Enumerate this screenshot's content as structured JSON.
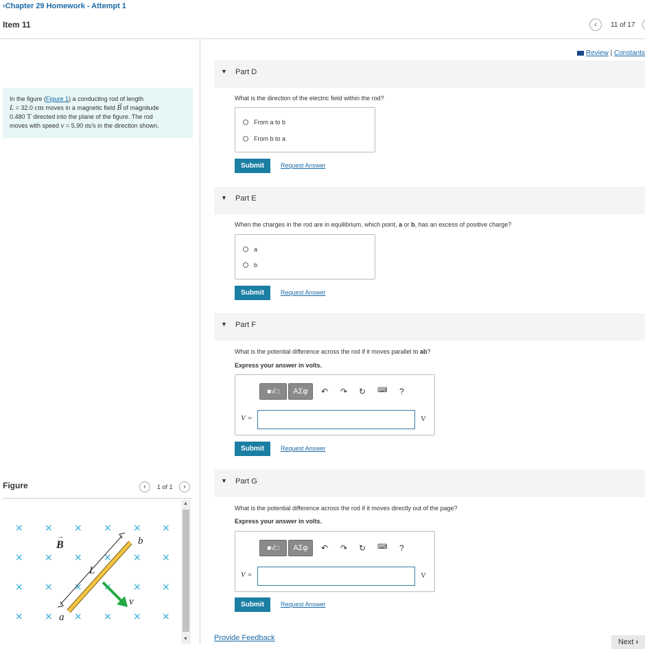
{
  "header": {
    "breadcrumb": "Chapter 29 Homework - Attempt 1",
    "item_title": "Item 11",
    "pager_text": "11 of 17",
    "review_link": "Review",
    "separator": "|",
    "constants_link": "Constants"
  },
  "intro": {
    "text_prefix": "In the figure (",
    "figure_link": "Figure 1",
    "text_a": ") a conducting rod of length",
    "L_sym": "L",
    "L_val": " = 32.0 ",
    "L_unit": "cm",
    "text_b": " moves in a magnetic field ",
    "B_sym": "B",
    "text_c": " of magnitude",
    "B_val": "0.480 ",
    "B_unit": "T",
    "text_d": " directed into the plane of the figure. The rod",
    "text_e": "moves with speed ",
    "v_sym": "v",
    "v_val": " = 5.90 ",
    "v_unit": "m/s",
    "text_f": " in the direction shown."
  },
  "figure": {
    "title": "Figure",
    "pager": "1 of 1",
    "label_B": "B",
    "label_L": "L",
    "label_a": "a",
    "label_b": "b",
    "label_v": "v",
    "rod_color": "#f5c542",
    "velocity_color": "#22aa44",
    "field_color": "#29a9d6"
  },
  "parts": [
    {
      "label": "Part D",
      "question": "What is the direction of the electric field within the rod?",
      "options": [
        "From a to b",
        "From b to a"
      ],
      "submit": "Submit",
      "request": "Request Answer"
    },
    {
      "label": "Part E",
      "question_a": "When the charges in the rod are in equilibrium, which point, ",
      "question_a_bold": "a",
      "question_or": " or ",
      "question_b_bold": "b",
      "question_end": ", has an excess of positive charge?",
      "options": [
        "a",
        "b"
      ],
      "submit": "Submit",
      "request": "Request Answer"
    },
    {
      "label": "Part F",
      "question_a": "What is the potential difference across the rod if it moves parallel to ",
      "question_bold": "ab",
      "question_end": "?",
      "note": "Express your answer in volts.",
      "symbols_btn": "ΑΣφ",
      "var": "V =",
      "unit": "V",
      "help": "?",
      "submit": "Submit",
      "request": "Request Answer"
    },
    {
      "label": "Part G",
      "question": "What is the potential difference across the rod if it moves directly out of the page?",
      "note": "Express your answer in volts.",
      "symbols_btn": "ΑΣφ",
      "var": "V =",
      "unit": "V",
      "help": "?",
      "submit": "Submit",
      "request": "Request Answer"
    }
  ],
  "footer": {
    "feedback": "Provide Feedback",
    "next": "Next"
  },
  "colors": {
    "accent": "#1b7ea3",
    "link": "#1a6aa8",
    "intro_bg": "#e7f6f6"
  }
}
